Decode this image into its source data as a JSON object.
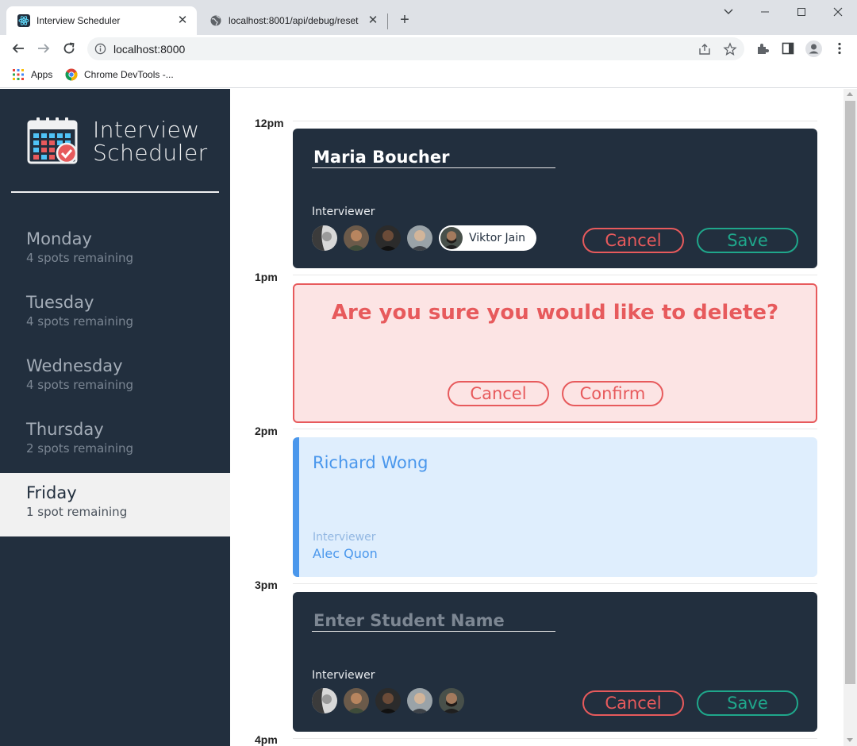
{
  "browser": {
    "tabs": [
      {
        "title": "Interview Scheduler",
        "active": true
      },
      {
        "title": "localhost:8001/api/debug/reset",
        "active": false
      }
    ],
    "url": "localhost:8000",
    "bookmarks": [
      "Apps",
      "Chrome DevTools -..."
    ]
  },
  "app": {
    "brand": [
      "Interview",
      "Scheduler"
    ],
    "days": [
      {
        "name": "Monday",
        "spots": "4 spots remaining",
        "selected": false
      },
      {
        "name": "Tuesday",
        "spots": "4 spots remaining",
        "selected": false
      },
      {
        "name": "Wednesday",
        "spots": "4 spots remaining",
        "selected": false
      },
      {
        "name": "Thursday",
        "spots": "2 spots remaining",
        "selected": false
      },
      {
        "name": "Friday",
        "spots": "1 spot remaining",
        "selected": true
      }
    ],
    "times": [
      "12pm",
      "1pm",
      "2pm",
      "3pm",
      "4pm"
    ],
    "appointments": {
      "edit": {
        "student_name": "Maria Boucher",
        "interviewer_label": "Interviewer",
        "selected_interviewer": "Viktor Jain",
        "cancel": "Cancel",
        "save": "Save"
      },
      "confirm": {
        "message": "Are you sure you would like to delete?",
        "cancel": "Cancel",
        "confirm": "Confirm"
      },
      "show": {
        "student": "Richard Wong",
        "interviewer_label": "Interviewer",
        "interviewer": "Alec Quon"
      },
      "create": {
        "placeholder": "Enter Student Name",
        "interviewer_label": "Interviewer",
        "cancel": "Cancel",
        "save": "Save"
      }
    },
    "colors": {
      "sidebar": "#222f3e",
      "danger": "#e75a5c",
      "confirm": "#1fa78b",
      "show": "#4a97ec"
    }
  }
}
